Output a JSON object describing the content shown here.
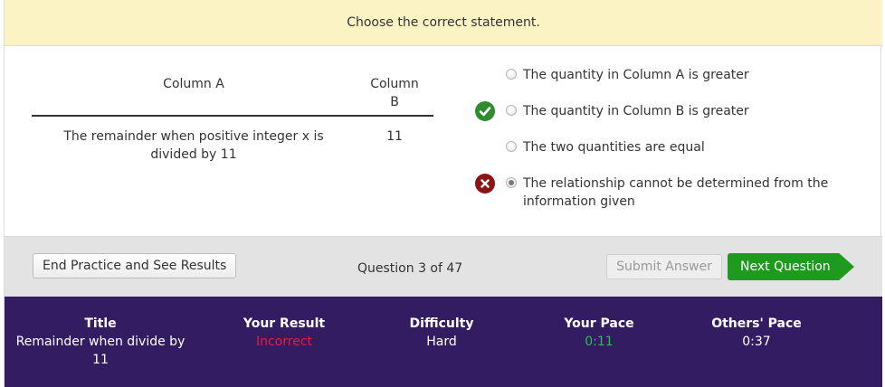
{
  "prompt": "Choose the correct statement.",
  "table": {
    "col_a_header": "Column A",
    "col_b_header": "Column\nB",
    "col_a_value": "The remainder when positive integer x is divided by 11",
    "col_b_value": "11"
  },
  "options": [
    {
      "label": "The quantity in Column A is greater",
      "status": "none",
      "selected": false
    },
    {
      "label": "The quantity in Column B is greater",
      "status": "correct",
      "selected": false
    },
    {
      "label": "The two quantities are equal",
      "status": "none",
      "selected": false
    },
    {
      "label": "The relationship cannot be determined from the information given",
      "status": "incorrect",
      "selected": true
    }
  ],
  "toolbar": {
    "end_label": "End Practice and See Results",
    "question_counter": "Question 3 of 47",
    "submit_label": "Submit Answer",
    "next_label": "Next Question"
  },
  "stats": {
    "title_header": "Title",
    "title_value": "Remainder when divide by 11",
    "result_header": "Your Result",
    "result_value": "Incorrect",
    "difficulty_header": "Difficulty",
    "difficulty_value": "Hard",
    "pace_header": "Your Pace",
    "pace_value": "0:11",
    "others_header": "Others' Pace",
    "others_value": "0:37"
  },
  "colors": {
    "prompt_bg": "#fcf3c5",
    "stats_bg": "#341c62",
    "next_button": "#1e9a1e",
    "correct_icon": "#2e8b2e",
    "incorrect_icon": "#8b1515",
    "incorrect_text": "#e0203a",
    "pace_text": "#2fbf4f"
  },
  "icons": {
    "correct": "checkmark-icon",
    "incorrect": "x-icon"
  }
}
